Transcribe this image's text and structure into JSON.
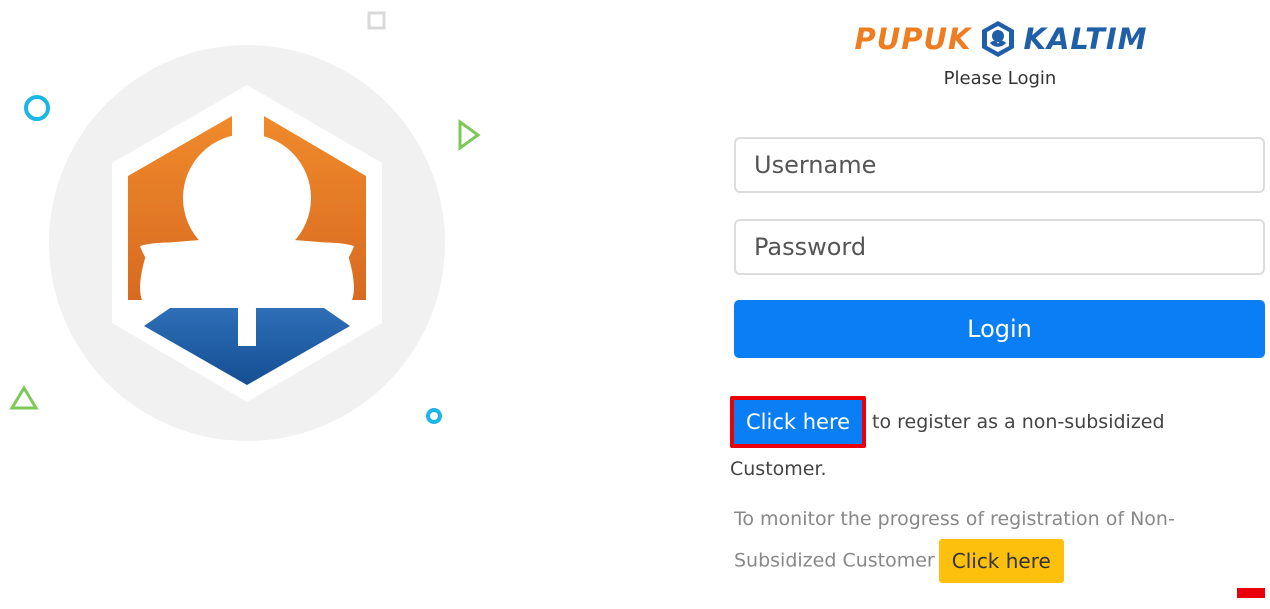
{
  "brand": {
    "left_word": "PUPUK",
    "right_word": "KALTIM",
    "colors": {
      "orange": "#ee7d22",
      "blue": "#1f5fa8"
    }
  },
  "login": {
    "subtitle": "Please Login",
    "username_placeholder": "Username",
    "password_placeholder": "Password",
    "login_label": "Login"
  },
  "register": {
    "button_label": "Click here",
    "text": "to register as a non-subsidized Customer."
  },
  "monitor": {
    "text": "To monitor the progress of registration of Non-Subsidized Customer",
    "button_label": "Click here"
  },
  "colors": {
    "primary": "#0a7ff5",
    "warning": "#fdc10d",
    "highlight": "#e8000b"
  }
}
